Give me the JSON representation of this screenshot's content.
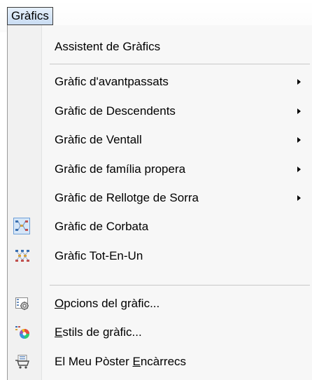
{
  "menubar": {
    "title": "Gràfics"
  },
  "menu": {
    "wizard": "Assistent de Gràfics",
    "items": [
      {
        "label": "Gràfic d'avantpassats"
      },
      {
        "label": "Gràfic de Descendents"
      },
      {
        "label": "Gràfic de Ventall"
      },
      {
        "label": "Gràfic de família propera"
      },
      {
        "label": "Gràfic de Rellotge de Sorra"
      },
      {
        "label": "Gràfic de Corbata"
      },
      {
        "label": "Gràfic Tot-En-Un"
      }
    ],
    "options": {
      "mnemonic": "O",
      "rest": "pcions del gràfic..."
    },
    "styles": {
      "mnemonic": "E",
      "rest": "stils de gràfic..."
    },
    "poster": {
      "pre": "El Meu Pòster ",
      "mnemonic": "E",
      "rest": "ncàrrecs"
    }
  },
  "icons": {
    "bowtie": "bowtie-chart-icon",
    "allinone": "all-in-one-chart-icon",
    "options": "chart-options-gear-icon",
    "styles": "chart-styles-palette-icon",
    "poster": "poster-cart-icon"
  }
}
